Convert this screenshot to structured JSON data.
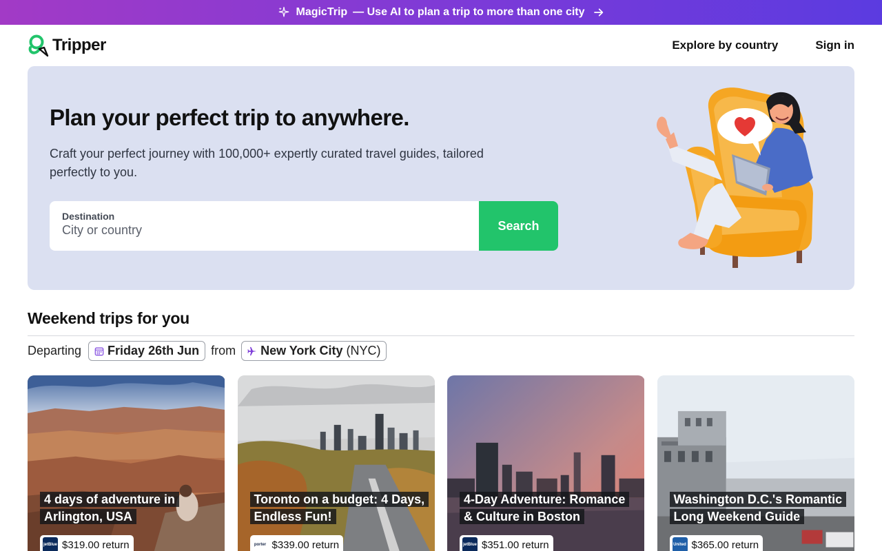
{
  "promo": {
    "brand": "MagicTrip",
    "text": "— Use AI to plan a trip to more than one city"
  },
  "header": {
    "logo_text": "Tripper",
    "nav": [
      "Explore by country",
      "Sign in"
    ]
  },
  "hero": {
    "title": "Plan your perfect trip to anywhere.",
    "subtitle": "Craft your perfect journey with 100,000+ expertly curated travel guides, tailored perfectly to you.",
    "search": {
      "label": "Destination",
      "placeholder": "City or country",
      "button": "Search"
    }
  },
  "weekend": {
    "title": "Weekend trips for you",
    "departing_label": "Departing",
    "date": "Friday 26th Jun",
    "from_label": "from",
    "city": "New York City",
    "city_code": "(NYC)"
  },
  "cards": [
    {
      "title": "4 days of adventure in Arlington, USA",
      "price": "$319.00 return",
      "airline": "jetBlue",
      "airline_color": "#0b2a5b"
    },
    {
      "title": "Toronto on a budget: 4 Days, Endless Fun!",
      "price": "$339.00 return",
      "airline": "porter",
      "airline_color": "#ffffff"
    },
    {
      "title": "4-Day Adventure: Romance & Culture in Boston",
      "price": "$351.00 return",
      "airline": "jetBlue",
      "airline_color": "#0b2a5b"
    },
    {
      "title": "Washington D.C.'s Romantic Long Weekend Guide",
      "price": "$365.00 return",
      "airline": "United",
      "airline_color": "#1f5fa8"
    }
  ],
  "colors": {
    "promo_start": "#a23ac6",
    "promo_end": "#5b3be0",
    "hero_bg": "#dbe0f1",
    "search_button": "#22c46b",
    "logo_green": "#22c46b"
  }
}
